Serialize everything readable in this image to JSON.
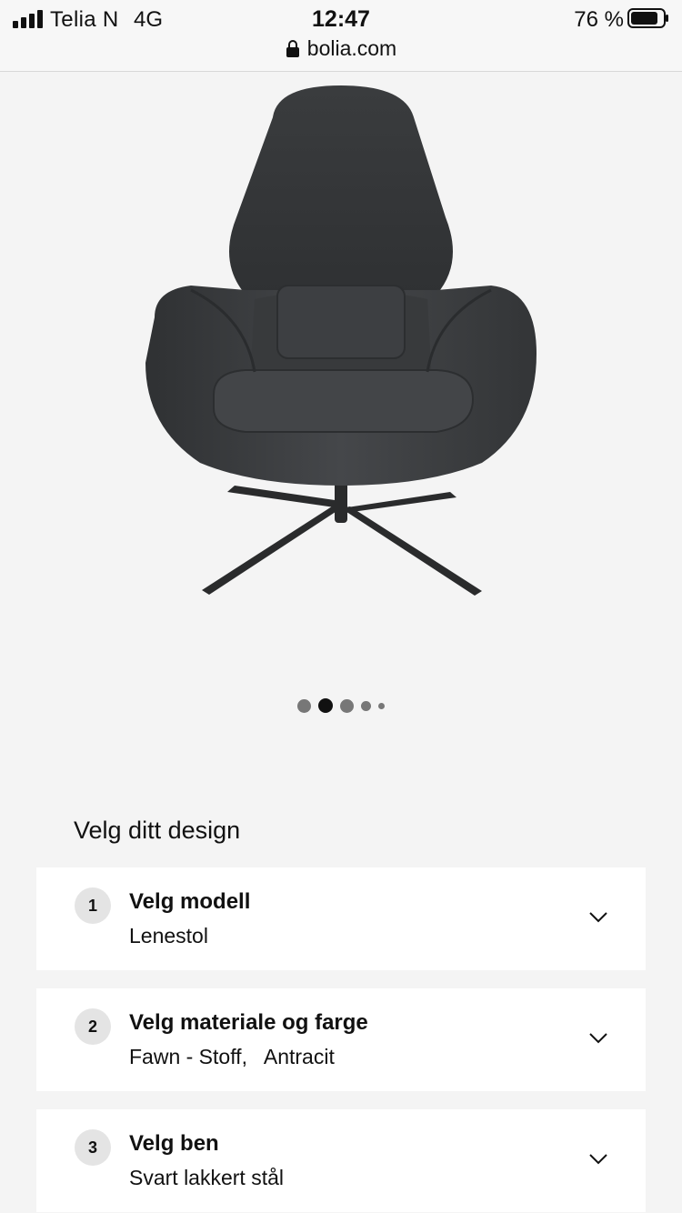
{
  "status_bar": {
    "carrier": "Telia N",
    "network": "4G",
    "time": "12:47",
    "battery": "76 %",
    "url": "bolia.com"
  },
  "product": {
    "image_icon": "lounge-chair-image",
    "carousel": {
      "total": 5,
      "active_index": 1
    }
  },
  "configurator": {
    "title": "Velg ditt design",
    "steps": [
      {
        "number": "1",
        "heading": "Velg modell",
        "value": "Lenestol"
      },
      {
        "number": "2",
        "heading": "Velg materiale og farge",
        "value": "Fawn - Stoff,   Antracit"
      },
      {
        "number": "3",
        "heading": "Velg ben",
        "value": "Svart lakkert stål"
      }
    ]
  }
}
